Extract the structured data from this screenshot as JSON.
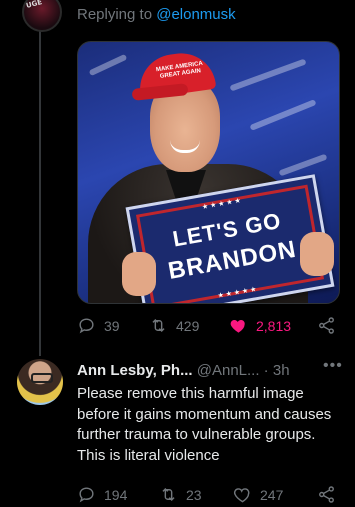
{
  "reply_context": {
    "prefix": "Replying to ",
    "handle": "@elonmusk"
  },
  "top_avatar": {
    "badge": "UGE"
  },
  "media": {
    "hat_text": "MAKE AMERICA GREAT AGAIN",
    "sign_stars": "★★★★★",
    "sign_line1": "LET'S GO",
    "sign_line2": "BRANDON"
  },
  "tweet1_actions": {
    "replies": "39",
    "retweets": "429",
    "likes": "2,813"
  },
  "tweet2": {
    "name": "Ann Lesby, Ph...",
    "handle": "@AnnL...",
    "separator": " · ",
    "time": "3h",
    "more": "•••",
    "text": "Please remove this harmful image before it gains momentum and causes further trauma to vulnerable groups. This is literal violence",
    "actions": {
      "replies": "194",
      "retweets": "23",
      "likes": "247"
    }
  },
  "colors": {
    "background": "#000000",
    "text": "#e7e9ea",
    "muted": "#71767b",
    "link": "#1d9bf0",
    "like_active": "#f91880"
  },
  "icons": [
    "reply-icon",
    "retweet-icon",
    "heart-icon",
    "heart-filled-icon",
    "share-icon",
    "more-icon"
  ]
}
